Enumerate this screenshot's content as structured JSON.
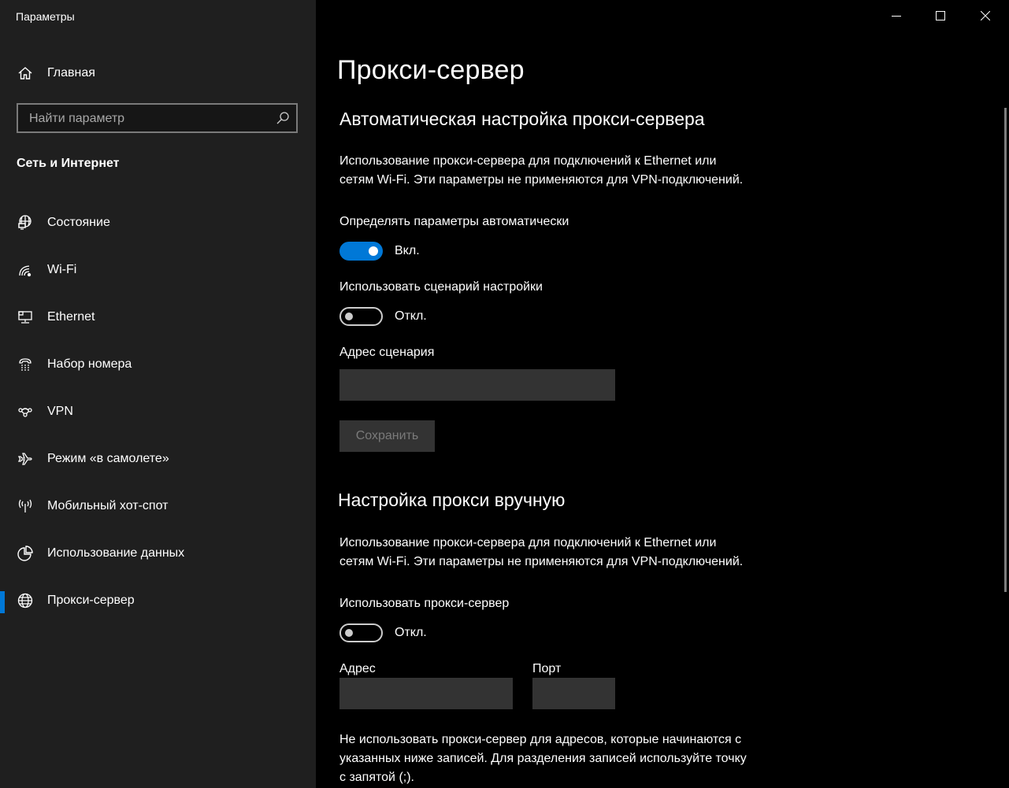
{
  "window": {
    "title": "Параметры",
    "controls": {
      "minimize": "minimize-icon",
      "maximize": "maximize-icon",
      "close": "close-icon"
    }
  },
  "sidebar": {
    "home_label": "Главная",
    "search_placeholder": "Найти параметр",
    "section_title": "Сеть и Интернет",
    "items": [
      {
        "label": "Состояние",
        "icon": "network-status-icon",
        "active": false
      },
      {
        "label": "Wi-Fi",
        "icon": "wifi-icon",
        "active": false
      },
      {
        "label": "Ethernet",
        "icon": "ethernet-icon",
        "active": false
      },
      {
        "label": "Набор номера",
        "icon": "dialup-icon",
        "active": false
      },
      {
        "label": "VPN",
        "icon": "vpn-icon",
        "active": false
      },
      {
        "label": "Режим «в самолете»",
        "icon": "airplane-icon",
        "active": false
      },
      {
        "label": "Мобильный хот-спот",
        "icon": "hotspot-icon",
        "active": false
      },
      {
        "label": "Использование данных",
        "icon": "data-usage-icon",
        "active": false
      },
      {
        "label": "Прокси-сервер",
        "icon": "globe-icon",
        "active": true
      }
    ],
    "accent_color": "#0078d7"
  },
  "main": {
    "page_title": "Прокси-сервер",
    "auto": {
      "heading": "Автоматическая настройка прокси-сервера",
      "description_line1": "Использование прокси-сервера для подключений к Ethernet или",
      "description_line2": "сетям Wi-Fi. Эти параметры не применяются для VPN-подключений.",
      "detect_label": "Определять параметры автоматически",
      "detect_on": true,
      "detect_state": "Вкл.",
      "script_label": "Использовать сценарий настройки",
      "script_on": false,
      "script_state": "Откл.",
      "script_address_label": "Адрес сценария",
      "script_address_value": "",
      "save_label": "Сохранить"
    },
    "manual": {
      "heading": "Настройка прокси вручную",
      "description_line1": "Использование прокси-сервера для подключений к Ethernet или",
      "description_line2": "сетям Wi-Fi. Эти параметры не применяются для VPN-подключений.",
      "use_proxy_label": "Использовать прокси-сервер",
      "use_proxy_on": false,
      "use_proxy_state": "Откл.",
      "address_label": "Адрес",
      "address_value": "",
      "port_label": "Порт",
      "port_value": "",
      "exceptions_line1": "Не использовать прокси-сервер для адресов, которые начинаются с",
      "exceptions_line2": "указанных ниже записей. Для разделения записей используйте точку",
      "exceptions_line3": "с запятой (;)."
    }
  }
}
